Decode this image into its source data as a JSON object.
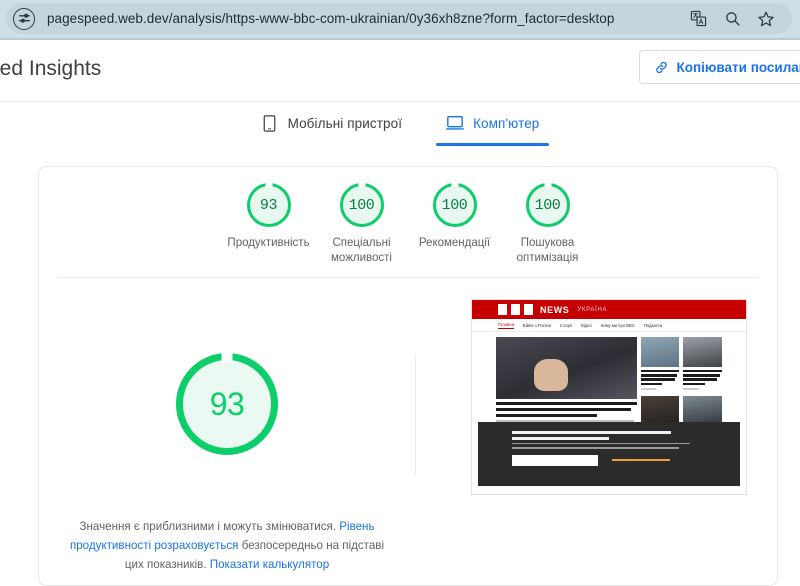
{
  "browser": {
    "url": "pagespeed.web.dev/analysis/https-www-bbc-com-ukrainian/0y36xh8zne?form_factor=desktop",
    "site_settings_icon": "tune-icon",
    "actions": [
      {
        "name": "translate-icon",
        "label": "Translate"
      },
      {
        "name": "search-icon",
        "label": "Search"
      },
      {
        "name": "bookmark-star-icon",
        "label": "Bookmark"
      }
    ]
  },
  "header": {
    "brand": "eed Insights",
    "copy_link_label": "Копіювати посилання",
    "copy_link_icon": "link-icon"
  },
  "tabs": [
    {
      "label": "Мобільні пристрої",
      "icon": "mobile-icon",
      "active": false
    },
    {
      "label": "Комп'ютер",
      "icon": "desktop-icon",
      "active": true
    }
  ],
  "scores": [
    {
      "value": "93",
      "label": "Продуктивність"
    },
    {
      "value": "100",
      "label": "Спеціальні можливості"
    },
    {
      "value": "100",
      "label": "Рекомендації"
    },
    {
      "value": "100",
      "label": "Пошукова оптимізація"
    }
  ],
  "performance": {
    "value": "93",
    "disclaimer_part1": "Значення є приблизними і можуть змінюватися. ",
    "disclaimer_link1": "Рівень продуктивності розраховується",
    "disclaimer_part2": " безпосередньо на підставі цих показників. ",
    "disclaimer_link2": "Показати калькулятор"
  },
  "screenshot": {
    "name": "page-screenshot-thumbnail",
    "brand": "NEWS",
    "brand_sub": "УКРАЇНА",
    "nav": [
      "Головна",
      "Війна з Росією",
      "Історії",
      "Відео",
      "Кому ми про BBC",
      "Подкасти"
    ]
  },
  "colors": {
    "good_green": "#0cce6b",
    "good_green_dark": "#0b8043",
    "accent_blue": "#1a73e8",
    "chrome": "#cfdee7",
    "bbc_red": "#c60000"
  }
}
